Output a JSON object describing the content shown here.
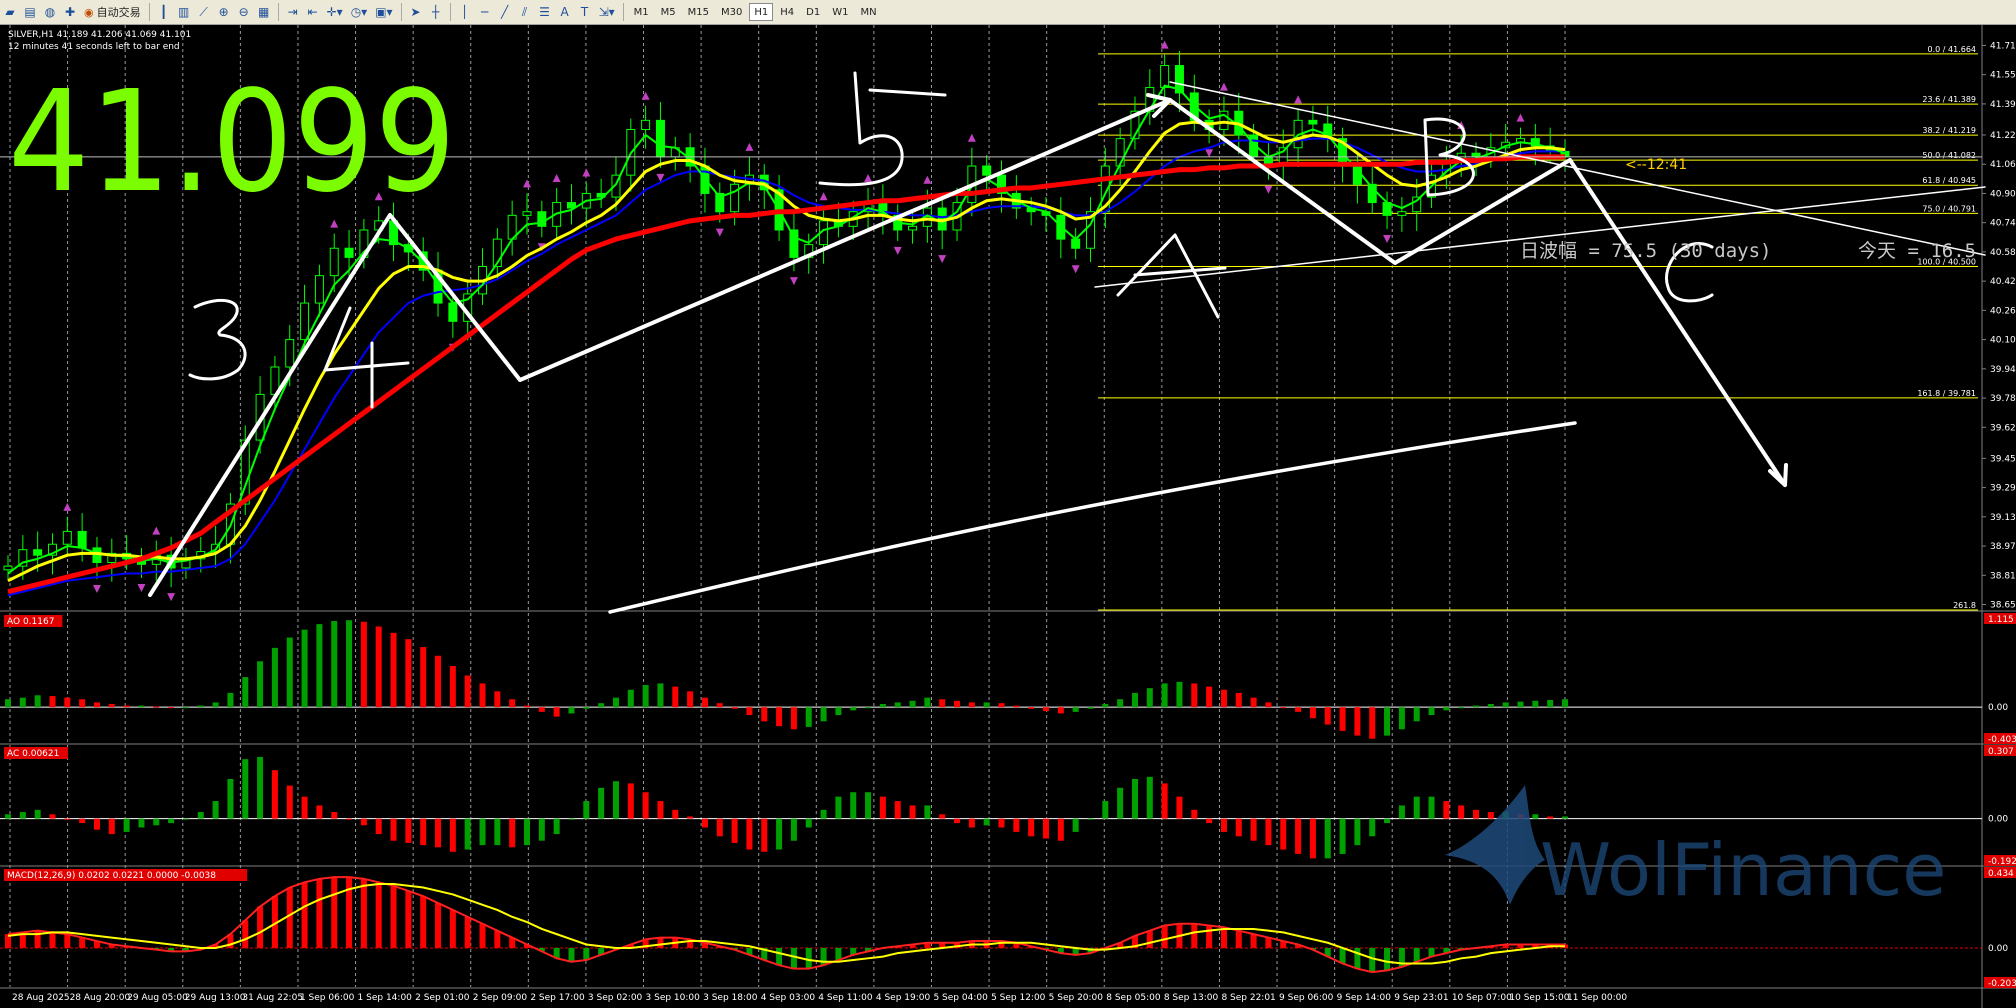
{
  "toolbar": {
    "trade_label": "自动交易",
    "timeframes": [
      "M1",
      "M5",
      "M15",
      "M30",
      "H1",
      "H4",
      "D1",
      "W1",
      "MN"
    ],
    "active_timeframe": "H1"
  },
  "header": {
    "symbol_line": "SILVER,H1  41.189 41.206 41.069 41.101",
    "countdown": "12 minutes 41 seconds left to bar end"
  },
  "overlay": {
    "big_price": "41.099",
    "range_text": "日波幅 = 75.5 (30 days)",
    "today_text": "今天 = 16.5",
    "timer": "<--12:41",
    "watermark": "WolFinance",
    "wave_labels": [
      "3",
      "4",
      "5",
      "A",
      "B",
      "C"
    ]
  },
  "colors": {
    "candle": "#00ff00",
    "ma_red": "#ff0000",
    "ma_yellow": "#ffff00",
    "ma_green": "#00ff00",
    "ma_blue": "#0000ff",
    "annotation": "#ffffff",
    "big_price": "#7cfc00",
    "fib": "#ffff00",
    "hist_up": "#00a000",
    "hist_down": "#ff0000",
    "watermark": "#1e4a7a"
  },
  "chart_data": {
    "type": "line",
    "symbol": "SILVER",
    "timeframe": "H1",
    "x_labels": [
      "28 Aug 2025",
      "28 Aug 20:00",
      "29 Aug 05:00",
      "29 Aug 13:00",
      "31 Aug 22:05",
      "1 Sep 06:00",
      "1 Sep 14:00",
      "2 Sep 01:00",
      "2 Sep 09:00",
      "2 Sep 17:00",
      "3 Sep 02:00",
      "3 Sep 10:00",
      "3 Sep 18:00",
      "4 Sep 03:00",
      "4 Sep 11:00",
      "4 Sep 19:00",
      "5 Sep 04:00",
      "5 Sep 12:00",
      "5 Sep 20:00",
      "8 Sep 05:00",
      "8 Sep 13:00",
      "8 Sep 22:01",
      "9 Sep 06:00",
      "9 Sep 14:00",
      "9 Sep 23:01",
      "10 Sep 07:00",
      "10 Sep 15:00",
      "11 Sep 00:00"
    ],
    "price_axis": {
      "ticks": [
        41.71,
        41.55,
        41.39,
        41.22,
        41.06,
        40.9,
        40.74,
        40.58,
        40.42,
        40.26,
        40.1,
        39.94,
        39.78,
        39.62,
        39.45,
        39.29,
        39.13,
        38.97,
        38.81,
        38.65
      ],
      "ylim": [
        38.62,
        41.8
      ]
    },
    "close": [
      38.86,
      38.95,
      38.92,
      38.98,
      39.05,
      38.96,
      38.88,
      38.93,
      38.9,
      38.87,
      38.92,
      38.85,
      38.9,
      38.94,
      38.98,
      39.2,
      39.55,
      39.8,
      39.95,
      40.1,
      40.3,
      40.45,
      40.6,
      40.55,
      40.7,
      40.75,
      40.62,
      40.58,
      40.48,
      40.3,
      40.2,
      40.35,
      40.5,
      40.65,
      40.78,
      40.8,
      40.72,
      40.85,
      40.82,
      40.9,
      40.88,
      41.0,
      41.25,
      41.3,
      41.1,
      41.15,
      41.05,
      40.9,
      40.8,
      40.95,
      41.0,
      40.92,
      40.7,
      40.55,
      40.62,
      40.75,
      40.72,
      40.8,
      40.85,
      40.78,
      40.7,
      40.72,
      40.82,
      40.7,
      40.85,
      41.05,
      41.0,
      40.9,
      40.82,
      40.8,
      40.78,
      40.65,
      40.6,
      40.8,
      41.05,
      41.2,
      41.35,
      41.48,
      41.6,
      41.45,
      41.3,
      41.25,
      41.35,
      41.22,
      41.1,
      41.05,
      41.15,
      41.3,
      41.28,
      41.2,
      41.05,
      40.95,
      40.85,
      40.78,
      40.8,
      40.88,
      41.0,
      41.08,
      41.12,
      41.1,
      41.15,
      41.18,
      41.2,
      41.16,
      41.13,
      41.1
    ],
    "ma_red": [
      38.72,
      38.74,
      38.76,
      38.78,
      38.8,
      38.82,
      38.84,
      38.86,
      38.88,
      38.9,
      38.93,
      38.96,
      39.0,
      39.04,
      39.1,
      39.16,
      39.22,
      39.28,
      39.34,
      39.4,
      39.46,
      39.52,
      39.58,
      39.64,
      39.7,
      39.76,
      39.82,
      39.88,
      39.94,
      40.0,
      40.06,
      40.12,
      40.18,
      40.24,
      40.3,
      40.36,
      40.42,
      40.48,
      40.54,
      40.59,
      40.62,
      40.65,
      40.67,
      40.69,
      40.71,
      40.73,
      40.75,
      40.76,
      40.77,
      40.78,
      40.78,
      40.79,
      40.8,
      40.8,
      40.81,
      40.82,
      40.83,
      40.84,
      40.85,
      40.86,
      40.86,
      40.87,
      40.88,
      40.89,
      40.9,
      40.9,
      40.91,
      40.92,
      40.93,
      40.93,
      40.94,
      40.95,
      40.96,
      40.97,
      40.98,
      40.99,
      41.0,
      41.01,
      41.02,
      41.03,
      41.03,
      41.04,
      41.04,
      41.05,
      41.05,
      41.05,
      41.06,
      41.06,
      41.06,
      41.06,
      41.06,
      41.06,
      41.06,
      41.06,
      41.06,
      41.07,
      41.07,
      41.07,
      41.08,
      41.08,
      41.09,
      41.09,
      41.1,
      41.1,
      41.1,
      41.1
    ],
    "ma_yellow": [
      38.78,
      38.82,
      38.86,
      38.89,
      38.92,
      38.93,
      38.93,
      38.92,
      38.92,
      38.91,
      38.91,
      38.9,
      38.9,
      38.91,
      38.93,
      38.98,
      39.08,
      39.22,
      39.38,
      39.55,
      39.72,
      39.88,
      40.02,
      40.14,
      40.26,
      40.38,
      40.46,
      40.5,
      40.5,
      40.48,
      40.44,
      40.42,
      40.42,
      40.45,
      40.5,
      40.56,
      40.6,
      40.65,
      40.69,
      40.74,
      40.78,
      40.84,
      40.93,
      41.02,
      41.06,
      41.08,
      41.08,
      41.05,
      41.0,
      40.97,
      40.96,
      40.95,
      40.9,
      40.83,
      40.78,
      40.76,
      40.75,
      40.76,
      40.78,
      40.78,
      40.76,
      40.75,
      40.76,
      40.75,
      40.77,
      40.82,
      40.86,
      40.87,
      40.86,
      40.85,
      40.83,
      40.8,
      40.76,
      40.77,
      40.83,
      40.92,
      41.02,
      41.13,
      41.23,
      41.28,
      41.29,
      41.28,
      41.29,
      41.28,
      41.24,
      41.2,
      41.18,
      41.2,
      41.22,
      41.21,
      41.18,
      41.12,
      41.06,
      41.0,
      40.95,
      40.94,
      40.96,
      40.99,
      41.03,
      41.05,
      41.08,
      41.11,
      41.14,
      41.15,
      41.15,
      41.14
    ],
    "ma_green": [
      38.82,
      38.88,
      38.9,
      38.93,
      38.97,
      38.96,
      38.93,
      38.92,
      38.91,
      38.89,
      38.9,
      38.88,
      38.89,
      38.91,
      38.95,
      39.08,
      39.3,
      39.52,
      39.72,
      39.9,
      40.08,
      40.24,
      40.4,
      40.48,
      40.58,
      40.65,
      40.64,
      40.6,
      40.52,
      40.4,
      40.3,
      40.32,
      40.4,
      40.52,
      40.65,
      40.73,
      40.74,
      40.79,
      40.81,
      40.86,
      40.87,
      40.95,
      41.12,
      41.22,
      41.16,
      41.15,
      41.09,
      40.98,
      40.88,
      40.91,
      40.96,
      40.94,
      40.81,
      40.66,
      40.63,
      40.7,
      40.72,
      40.77,
      40.82,
      40.8,
      40.74,
      40.73,
      40.78,
      40.74,
      40.8,
      40.94,
      40.98,
      40.93,
      40.86,
      40.82,
      40.8,
      40.72,
      40.65,
      40.73,
      40.9,
      41.06,
      41.22,
      41.36,
      41.49,
      41.47,
      41.38,
      41.31,
      41.33,
      41.27,
      41.17,
      41.1,
      41.13,
      41.22,
      41.25,
      41.22,
      41.12,
      41.03,
      40.93,
      40.85,
      40.82,
      40.86,
      40.94,
      41.02,
      41.08,
      41.09,
      41.12,
      41.16,
      41.18,
      41.17,
      41.15,
      41.12
    ],
    "ma_blue": [
      38.7,
      38.72,
      38.74,
      38.76,
      38.78,
      38.79,
      38.8,
      38.81,
      38.82,
      38.82,
      38.83,
      38.83,
      38.84,
      38.85,
      38.86,
      38.9,
      38.98,
      39.1,
      39.22,
      39.36,
      39.5,
      39.64,
      39.78,
      39.9,
      40.02,
      40.14,
      40.22,
      40.3,
      40.34,
      40.36,
      40.37,
      40.38,
      40.4,
      40.43,
      40.48,
      40.53,
      40.57,
      40.62,
      40.66,
      40.7,
      40.74,
      40.78,
      40.85,
      40.92,
      40.96,
      41.0,
      41.02,
      41.02,
      41.0,
      40.99,
      40.98,
      40.97,
      40.94,
      40.89,
      40.85,
      40.83,
      40.82,
      40.81,
      40.81,
      40.8,
      40.79,
      40.78,
      40.78,
      40.77,
      40.78,
      40.8,
      40.82,
      40.83,
      40.83,
      40.83,
      40.82,
      40.8,
      40.78,
      40.78,
      40.8,
      40.85,
      40.91,
      40.98,
      41.05,
      41.1,
      41.13,
      41.15,
      41.18,
      41.19,
      41.19,
      41.18,
      41.18,
      41.19,
      41.2,
      41.2,
      41.18,
      41.15,
      41.11,
      41.07,
      41.04,
      41.02,
      41.02,
      41.03,
      41.05,
      41.06,
      41.08,
      41.1,
      41.12,
      41.13,
      41.13,
      41.13
    ],
    "fibonacci": [
      {
        "label": "0.0 / 41.664",
        "price": 41.664
      },
      {
        "label": "23.6 / 41.389",
        "price": 41.389
      },
      {
        "label": "38.2 / 41.219",
        "price": 41.219
      },
      {
        "label": "50.0 / 41.082",
        "price": 41.082
      },
      {
        "label": "61.8 / 40.945",
        "price": 40.945
      },
      {
        "label": "75.0 / 40.791",
        "price": 40.791
      },
      {
        "label": "100.0 / 40.500",
        "price": 40.5
      },
      {
        "label": "161.8 / 39.781",
        "price": 39.781
      },
      {
        "label": "261.8",
        "price": 38.62
      }
    ],
    "indicators": [
      {
        "name": "AO 0.1167",
        "ticks": [
          "1.115",
          "0.00",
          "-0.403"
        ],
        "range": [
          -0.403,
          1.115
        ],
        "values": [
          0.1,
          0.12,
          0.15,
          0.14,
          0.12,
          0.1,
          0.06,
          0.04,
          0.02,
          0.02,
          0.01,
          0.0,
          0.0,
          0.02,
          0.06,
          0.18,
          0.38,
          0.58,
          0.75,
          0.88,
          0.98,
          1.05,
          1.09,
          1.1,
          1.08,
          1.02,
          0.94,
          0.86,
          0.76,
          0.65,
          0.52,
          0.4,
          0.3,
          0.2,
          0.1,
          0.02,
          -0.06,
          -0.12,
          -0.08,
          -0.02,
          0.05,
          0.12,
          0.22,
          0.28,
          0.3,
          0.26,
          0.2,
          0.12,
          0.05,
          -0.02,
          -0.1,
          -0.18,
          -0.24,
          -0.28,
          -0.25,
          -0.18,
          -0.1,
          -0.04,
          0.0,
          0.04,
          0.06,
          0.08,
          0.12,
          0.1,
          0.08,
          0.06,
          0.06,
          0.05,
          0.02,
          -0.02,
          -0.05,
          -0.08,
          -0.06,
          -0.02,
          0.04,
          0.1,
          0.18,
          0.24,
          0.3,
          0.32,
          0.3,
          0.26,
          0.22,
          0.18,
          0.12,
          0.06,
          0.0,
          -0.06,
          -0.14,
          -0.22,
          -0.3,
          -0.36,
          -0.4,
          -0.36,
          -0.28,
          -0.18,
          -0.1,
          -0.04,
          0.0,
          0.02,
          0.04,
          0.06,
          0.07,
          0.08,
          0.09,
          0.1
        ]
      },
      {
        "name": "AC 0.00621",
        "ticks": [
          "0.307",
          "0.00",
          "-0.192"
        ],
        "range": [
          -0.192,
          0.307
        ],
        "values": [
          0.02,
          0.03,
          0.04,
          0.02,
          0.0,
          -0.02,
          -0.05,
          -0.07,
          -0.06,
          -0.04,
          -0.03,
          -0.02,
          0.0,
          0.03,
          0.08,
          0.18,
          0.27,
          0.28,
          0.22,
          0.15,
          0.1,
          0.06,
          0.03,
          0.0,
          -0.03,
          -0.07,
          -0.1,
          -0.11,
          -0.12,
          -0.13,
          -0.15,
          -0.14,
          -0.12,
          -0.12,
          -0.13,
          -0.12,
          -0.1,
          -0.07,
          0.0,
          0.08,
          0.14,
          0.17,
          0.16,
          0.12,
          0.08,
          0.04,
          0.01,
          -0.04,
          -0.08,
          -0.11,
          -0.14,
          -0.15,
          -0.14,
          -0.1,
          -0.04,
          0.04,
          0.1,
          0.12,
          0.12,
          0.1,
          0.08,
          0.06,
          0.06,
          0.02,
          -0.02,
          -0.04,
          -0.03,
          -0.04,
          -0.06,
          -0.08,
          -0.09,
          -0.1,
          -0.06,
          0.0,
          0.08,
          0.14,
          0.18,
          0.19,
          0.16,
          0.1,
          0.04,
          -0.02,
          -0.06,
          -0.08,
          -0.1,
          -0.12,
          -0.14,
          -0.16,
          -0.18,
          -0.18,
          -0.16,
          -0.12,
          -0.08,
          -0.02,
          0.06,
          0.1,
          0.1,
          0.08,
          0.06,
          0.04,
          0.03,
          0.03,
          0.02,
          0.02,
          0.01,
          0.01
        ]
      },
      {
        "name": "MACD(12,26,9) 0.0202 0.0221 0.0000 -0.0038",
        "ticks": [
          "0.434",
          "0.00",
          "-0.203"
        ],
        "range": [
          -0.203,
          0.434
        ],
        "values": [
          0.08,
          0.09,
          0.1,
          0.09,
          0.08,
          0.06,
          0.04,
          0.02,
          0.01,
          0.0,
          -0.01,
          -0.02,
          -0.02,
          -0.01,
          0.02,
          0.08,
          0.16,
          0.24,
          0.3,
          0.35,
          0.38,
          0.4,
          0.41,
          0.41,
          0.4,
          0.38,
          0.36,
          0.33,
          0.3,
          0.26,
          0.22,
          0.18,
          0.14,
          0.1,
          0.06,
          0.02,
          -0.02,
          -0.06,
          -0.08,
          -0.07,
          -0.04,
          -0.01,
          0.02,
          0.05,
          0.06,
          0.06,
          0.05,
          0.03,
          0.01,
          -0.01,
          -0.04,
          -0.07,
          -0.1,
          -0.12,
          -0.12,
          -0.1,
          -0.07,
          -0.04,
          -0.02,
          0.0,
          0.01,
          0.02,
          0.03,
          0.03,
          0.03,
          0.04,
          0.04,
          0.04,
          0.03,
          0.01,
          -0.01,
          -0.03,
          -0.04,
          -0.03,
          0.0,
          0.03,
          0.07,
          0.1,
          0.13,
          0.14,
          0.14,
          0.13,
          0.12,
          0.1,
          0.08,
          0.06,
          0.04,
          0.02,
          -0.01,
          -0.05,
          -0.09,
          -0.12,
          -0.14,
          -0.13,
          -0.11,
          -0.08,
          -0.05,
          -0.03,
          -0.01,
          0.0,
          0.01,
          0.02,
          0.02,
          0.02,
          0.02,
          0.02
        ],
        "signal": [
          0.07,
          0.08,
          0.08,
          0.09,
          0.09,
          0.08,
          0.07,
          0.06,
          0.05,
          0.04,
          0.03,
          0.02,
          0.01,
          0.0,
          0.0,
          0.02,
          0.05,
          0.09,
          0.14,
          0.19,
          0.24,
          0.28,
          0.31,
          0.34,
          0.36,
          0.37,
          0.37,
          0.36,
          0.35,
          0.33,
          0.31,
          0.28,
          0.25,
          0.22,
          0.18,
          0.15,
          0.11,
          0.08,
          0.05,
          0.02,
          0.01,
          0.0,
          0.0,
          0.01,
          0.02,
          0.03,
          0.04,
          0.04,
          0.03,
          0.02,
          0.01,
          -0.01,
          -0.03,
          -0.05,
          -0.07,
          -0.08,
          -0.08,
          -0.07,
          -0.06,
          -0.05,
          -0.03,
          -0.02,
          -0.01,
          0.0,
          0.01,
          0.02,
          0.02,
          0.03,
          0.03,
          0.03,
          0.02,
          0.01,
          0.0,
          -0.01,
          -0.01,
          0.0,
          0.01,
          0.03,
          0.05,
          0.07,
          0.09,
          0.1,
          0.11,
          0.11,
          0.11,
          0.1,
          0.09,
          0.07,
          0.05,
          0.03,
          0.0,
          -0.03,
          -0.06,
          -0.08,
          -0.09,
          -0.09,
          -0.09,
          -0.08,
          -0.06,
          -0.05,
          -0.03,
          -0.02,
          -0.01,
          0.0,
          0.01,
          0.01
        ]
      }
    ]
  }
}
